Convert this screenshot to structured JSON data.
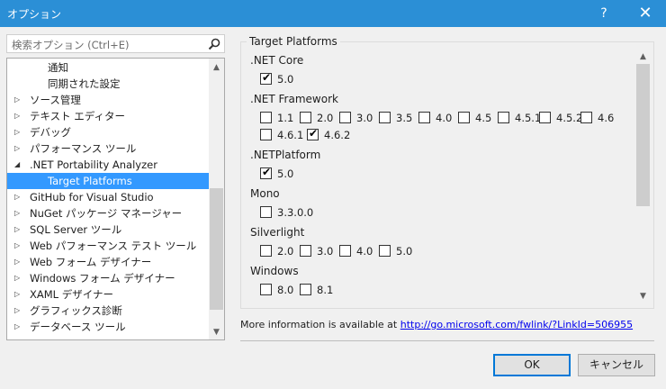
{
  "window": {
    "title": "オプション",
    "help": "?",
    "close": "✕"
  },
  "search": {
    "placeholder": "検索オプション (Ctrl+E)"
  },
  "tree": {
    "items": [
      {
        "label": "通知",
        "indent": 2,
        "expander": "",
        "selected": false
      },
      {
        "label": "同期された設定",
        "indent": 2,
        "expander": "",
        "selected": false
      },
      {
        "label": "ソース管理",
        "indent": 1,
        "expander": "▷",
        "selected": false
      },
      {
        "label": "テキスト エディター",
        "indent": 1,
        "expander": "▷",
        "selected": false
      },
      {
        "label": "デバッグ",
        "indent": 1,
        "expander": "▷",
        "selected": false
      },
      {
        "label": "パフォーマンス ツール",
        "indent": 1,
        "expander": "▷",
        "selected": false
      },
      {
        "label": ".NET Portability Analyzer",
        "indent": 1,
        "expander": "◢",
        "selected": false
      },
      {
        "label": "Target Platforms",
        "indent": 2,
        "expander": "",
        "selected": true
      },
      {
        "label": "GitHub for Visual Studio",
        "indent": 1,
        "expander": "▷",
        "selected": false
      },
      {
        "label": "NuGet パッケージ マネージャー",
        "indent": 1,
        "expander": "▷",
        "selected": false
      },
      {
        "label": "SQL Server ツール",
        "indent": 1,
        "expander": "▷",
        "selected": false
      },
      {
        "label": "Web パフォーマンス テスト ツール",
        "indent": 1,
        "expander": "▷",
        "selected": false
      },
      {
        "label": "Web フォーム デザイナー",
        "indent": 1,
        "expander": "▷",
        "selected": false
      },
      {
        "label": "Windows フォーム デザイナー",
        "indent": 1,
        "expander": "▷",
        "selected": false
      },
      {
        "label": "XAML デザイナー",
        "indent": 1,
        "expander": "▷",
        "selected": false
      },
      {
        "label": "グラフィックス診断",
        "indent": 1,
        "expander": "▷",
        "selected": false
      },
      {
        "label": "データベース ツール",
        "indent": 1,
        "expander": "▷",
        "selected": false
      }
    ]
  },
  "group": {
    "title": "Target Platforms"
  },
  "platforms": [
    {
      "name": ".NET Core",
      "rows": [
        [
          {
            "label": "5.0",
            "checked": true
          }
        ]
      ]
    },
    {
      "name": ".NET Framework",
      "rows": [
        [
          {
            "label": "1.1",
            "checked": false
          },
          {
            "label": "2.0",
            "checked": false
          },
          {
            "label": "3.0",
            "checked": false
          },
          {
            "label": "3.5",
            "checked": false
          },
          {
            "label": "4.0",
            "checked": false
          },
          {
            "label": "4.5",
            "checked": false
          },
          {
            "label": "4.5.1",
            "checked": false
          },
          {
            "label": "4.5.2",
            "checked": false
          },
          {
            "label": "4.6",
            "checked": false
          }
        ],
        [
          {
            "label": "4.6.1",
            "checked": false
          },
          {
            "label": "4.6.2",
            "checked": true
          }
        ]
      ]
    },
    {
      "name": ".NETPlatform",
      "rows": [
        [
          {
            "label": "5.0",
            "checked": true
          }
        ]
      ]
    },
    {
      "name": "Mono",
      "rows": [
        [
          {
            "label": "3.3.0.0",
            "checked": false
          }
        ]
      ]
    },
    {
      "name": "Silverlight",
      "rows": [
        [
          {
            "label": "2.0",
            "checked": false
          },
          {
            "label": "3.0",
            "checked": false
          },
          {
            "label": "4.0",
            "checked": false
          },
          {
            "label": "5.0",
            "checked": false
          }
        ]
      ]
    },
    {
      "name": "Windows",
      "rows": [
        [
          {
            "label": "8.0",
            "checked": false
          },
          {
            "label": "8.1",
            "checked": false
          }
        ]
      ]
    }
  ],
  "more_info": {
    "text": "More information is available at ",
    "link": "http://go.microsoft.com/fwlink/?LinkId=506955"
  },
  "buttons": {
    "ok": "OK",
    "cancel": "キャンセル"
  },
  "icons": {
    "search": "search-icon",
    "scroll_up": "▲",
    "scroll_down": "▼"
  }
}
